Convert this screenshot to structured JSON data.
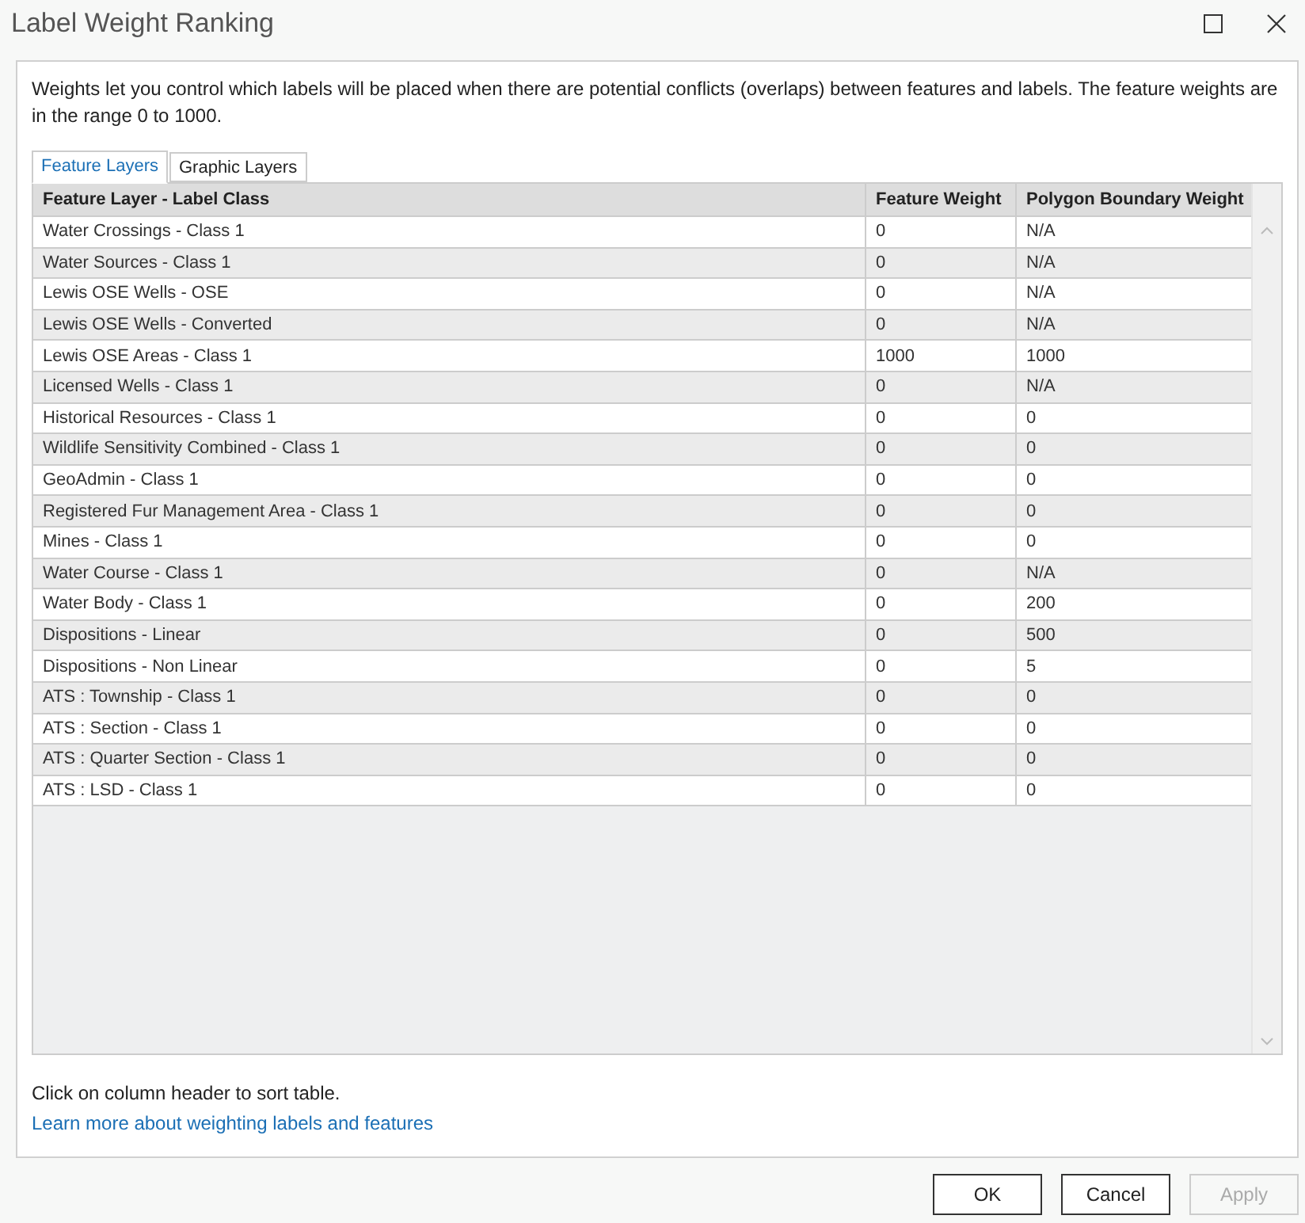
{
  "window": {
    "title": "Label Weight Ranking"
  },
  "description": "Weights let you control which labels will be placed when there are potential conflicts (overlaps) between features and labels. The feature weights are in the range 0 to 1000.",
  "tabs": [
    {
      "label": "Feature Layers",
      "selected": true
    },
    {
      "label": "Graphic Layers",
      "selected": false
    }
  ],
  "table": {
    "columns": [
      "Feature Layer - Label Class",
      "Feature Weight",
      "Polygon Boundary Weight"
    ],
    "rows": [
      [
        "Water Crossings - Class 1",
        "0",
        "N/A"
      ],
      [
        "Water Sources - Class 1",
        "0",
        "N/A"
      ],
      [
        "Lewis OSE Wells - OSE",
        "0",
        "N/A"
      ],
      [
        "Lewis OSE Wells - Converted",
        "0",
        "N/A"
      ],
      [
        "Lewis OSE Areas - Class 1",
        "1000",
        "1000"
      ],
      [
        "Licensed Wells - Class 1",
        "0",
        "N/A"
      ],
      [
        "Historical Resources - Class 1",
        "0",
        "0"
      ],
      [
        "Wildlife Sensitivity Combined - Class 1",
        "0",
        "0"
      ],
      [
        "GeoAdmin - Class 1",
        "0",
        "0"
      ],
      [
        "Registered Fur Management Area - Class 1",
        "0",
        "0"
      ],
      [
        "Mines - Class 1",
        "0",
        "0"
      ],
      [
        "Water Course - Class 1",
        "0",
        "N/A"
      ],
      [
        "Water Body - Class 1",
        "0",
        "200"
      ],
      [
        "Dispositions - Linear",
        "0",
        "500"
      ],
      [
        "Dispositions - Non Linear",
        "0",
        "5"
      ],
      [
        "ATS : Township - Class 1",
        "0",
        "0"
      ],
      [
        "ATS : Section - Class 1",
        "0",
        "0"
      ],
      [
        "ATS : Quarter Section - Class 1",
        "0",
        "0"
      ],
      [
        "ATS : LSD - Class 1",
        "0",
        "0"
      ]
    ]
  },
  "hint": "Click on column header to sort table.",
  "link": "Learn more about weighting labels and features",
  "buttons": [
    {
      "label": "OK",
      "disabled": false
    },
    {
      "label": "Cancel",
      "disabled": false
    },
    {
      "label": "Apply",
      "disabled": true
    }
  ]
}
